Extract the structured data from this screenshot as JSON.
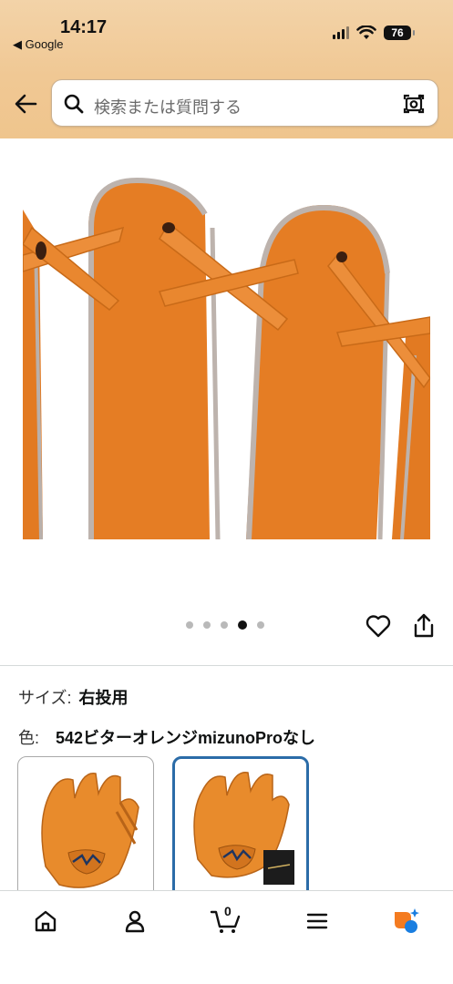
{
  "status_bar": {
    "time": "14:17",
    "back_app": "◀ Google",
    "battery": "76"
  },
  "search": {
    "placeholder": "検索または質問する"
  },
  "product": {
    "image_icon": "baseball-glove-laces-closeup",
    "carousel": {
      "count": 5,
      "active_index": 3
    }
  },
  "variations": {
    "size_label": "サイズ:",
    "size_value": "右投用",
    "color_label": "色:",
    "color_value": "542ビターオレンジmizunoProなし",
    "swatches": [
      {
        "name": "glove-only",
        "selected": false
      },
      {
        "name": "glove-with-bag",
        "selected": true
      }
    ]
  },
  "bottom_nav": {
    "items": [
      "home-icon",
      "account-icon",
      "cart-icon",
      "menu-icon",
      "ai-assistant-icon"
    ],
    "cart_count": "0"
  },
  "colors": {
    "header_bg": "#f0c894",
    "glove_orange": "#e67a1f",
    "selected_border": "#2b6ca8"
  }
}
